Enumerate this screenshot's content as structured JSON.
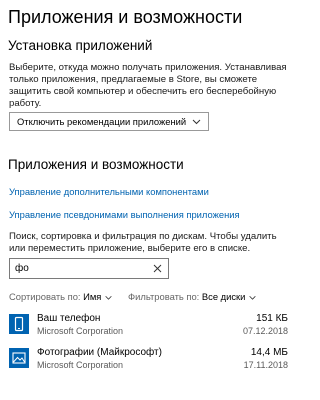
{
  "page": {
    "title": "Приложения и возможности"
  },
  "install_section": {
    "heading": "Установка приложений",
    "description": "Выберите, откуда можно получать приложения. Устанавливая только приложения, предлагаемые в Store, вы сможете защитить свой компьютер и обеспечить его бесперебойную работу.",
    "dropdown_value": "Отключить рекомендации приложений"
  },
  "apps_section": {
    "heading": "Приложения и возможности",
    "link_optional": "Управление дополнительными компонентами",
    "link_aliases": "Управление псевдонимами выполнения приложения",
    "description": "Поиск, сортировка и фильтрация по дискам. Чтобы удалить или переместить приложение, выберите его в списке.",
    "search_value": "фо",
    "sort_label": "Сортировать по:",
    "sort_value": "Имя",
    "filter_label": "Фильтровать по:",
    "filter_value": "Все диски"
  },
  "apps": [
    {
      "name": "Ваш телефон",
      "publisher": "Microsoft Corporation",
      "size": "151 КБ",
      "date": "07.12.2018",
      "icon": "phone-icon"
    },
    {
      "name": "Фотографии (Майкрософт)",
      "publisher": "Microsoft Corporation",
      "size": "14,4 МБ",
      "date": "17.11.2018",
      "icon": "photos-icon"
    }
  ],
  "colors": {
    "accent": "#0063b1",
    "link": "#0063b1"
  }
}
